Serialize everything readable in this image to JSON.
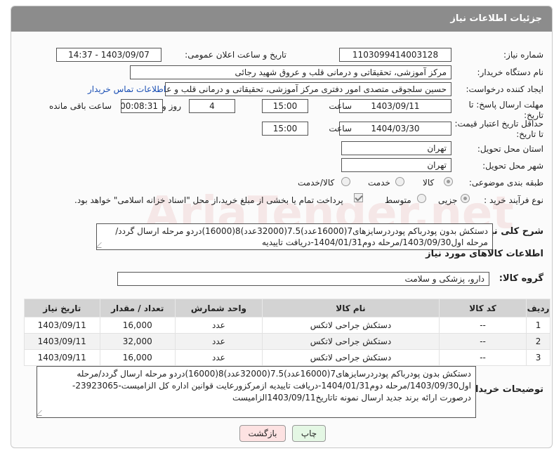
{
  "header": {
    "title": "جزئیات اطلاعات نیاز"
  },
  "fields": {
    "need_number_label": "شماره نیاز:",
    "need_number": "1103099414003128",
    "announce_label": "تاریخ و ساعت اعلان عمومی:",
    "announce_value": "1403/09/07 - 14:37",
    "buyer_org_label": "نام دستگاه خریدار:",
    "buyer_org": "مرکز آموزشی، تحقیقاتی و درمانی قلب و عروق شهید رجائی",
    "creator_label": "ایجاد کننده درخواست:",
    "creator": "حسین سلجوقی متصدی امور دفتری مرکز آموزشی، تحقیقاتی و درمانی قلب و عروق",
    "contact_link": "اطلاعات تماس خریدار",
    "deadline_label": "مهلت ارسال پاسخ: تا تاریخ:",
    "deadline_date": "1403/09/11",
    "time_label": "ساعت",
    "deadline_time": "15:00",
    "days_value": "4",
    "days_label": "روز و",
    "remaining_time": "00:08:31",
    "remaining_label": "ساعت باقی مانده",
    "validity_label": "حداقل تاریخ اعتبار قیمت: تا تاریخ:",
    "validity_date": "1404/03/30",
    "validity_time": "15:00",
    "province_label": "استان محل تحویل:",
    "province": "تهران",
    "city_label": "شهر محل تحویل:",
    "city": "تهران",
    "category_label": "طبقه بندی موضوعی:",
    "category_options": [
      "کالا",
      "خدمت",
      "کالا/خدمت"
    ],
    "process_label": "نوع فرآیند خرید :",
    "process_options": [
      "جزیی",
      "متوسط"
    ],
    "payment_note": "پرداخت تمام یا بخشی از مبلغ خرید،از محل \"اسناد خزانه اسلامی\" خواهد بود.",
    "summary_label": "شرح کلی نیاز:",
    "summary": "دستکش بدون پودرباکم پودردرسایزهای7(16000عدد)7.5(32000عدد)8(16000)دردو مرحله ارسال گردد/مرحله اول1403/09/30/مرحله دوم1404/01/31-دریافت تاییدیه",
    "goods_info_title": "اطلاعات کالاهای مورد نیاز",
    "goods_group_label": "گروه کالا:",
    "goods_group": "دارو، پزشکی و سلامت",
    "buyer_notes_label": "توضیحات خریدار:",
    "buyer_notes": "دستکش بدون پودرباکم پودردرسایزهای7(16000عدد)7.5(32000عدد)8(16000)دردو مرحله ارسال گردد/مرحله اول1403/09/30/مرحله دوم1404/01/31-دریافت تاییدیه ازمرکزورعایت قوانین اداره کل الزامیست-23923065-درصورت ارائه برند جدید ارسال نمونه تاتاریخ1403/09/11الزامیست"
  },
  "table": {
    "headers": [
      "ردیف",
      "کد کالا",
      "نام کالا",
      "واحد شمارش",
      "تعداد / مقدار",
      "تاریخ نیاز"
    ],
    "rows": [
      [
        "1",
        "--",
        "دستکش جراحی لاتکس",
        "عدد",
        "16,000",
        "1403/09/11"
      ],
      [
        "2",
        "--",
        "دستکش جراحی لاتکس",
        "عدد",
        "32,000",
        "1403/09/11"
      ],
      [
        "3",
        "--",
        "دستکش جراحی لاتکس",
        "عدد",
        "16,000",
        "1403/09/11"
      ]
    ]
  },
  "buttons": {
    "print": "چاپ",
    "back": "بازگشت"
  },
  "watermark": "AriaTender.net",
  "colors": {
    "header": "#8c8c8c",
    "link": "#1a4fb4",
    "table_header": "#d3d3d3"
  }
}
